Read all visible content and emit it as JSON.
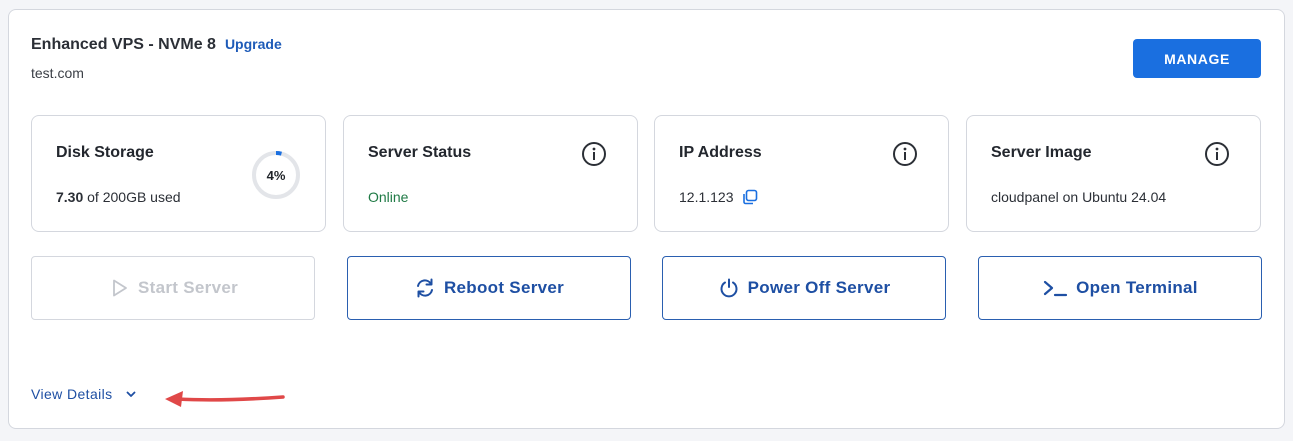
{
  "header": {
    "plan_name": "Enhanced VPS - NVMe 8",
    "upgrade_label": "Upgrade",
    "domain": "test.com",
    "manage_label": "MANAGE"
  },
  "tiles": {
    "disk": {
      "title": "Disk Storage",
      "used": "7.30",
      "of_text": "of 200GB used",
      "percent_label": "4%",
      "percent": 4
    },
    "status": {
      "title": "Server Status",
      "value": "Online"
    },
    "ip": {
      "title": "IP Address",
      "value": "12.1.123"
    },
    "image": {
      "title": "Server Image",
      "value": "cloudpanel on Ubuntu 24.04"
    }
  },
  "actions": {
    "start": "Start Server",
    "reboot": "Reboot Server",
    "power_off": "Power Off Server",
    "terminal": "Open Terminal"
  },
  "footer": {
    "view_details": "View Details"
  },
  "colors": {
    "primary": "#1a6fe0",
    "link": "#1e5bb8",
    "online": "#1f7a45",
    "annotation_arrow": "#e04848"
  },
  "icons": {
    "info": "info-circle-icon",
    "copy": "copy-icon",
    "play": "play-icon",
    "refresh": "refresh-icon",
    "power": "power-icon",
    "terminal": "terminal-icon",
    "chevron": "chevron-down-icon"
  }
}
